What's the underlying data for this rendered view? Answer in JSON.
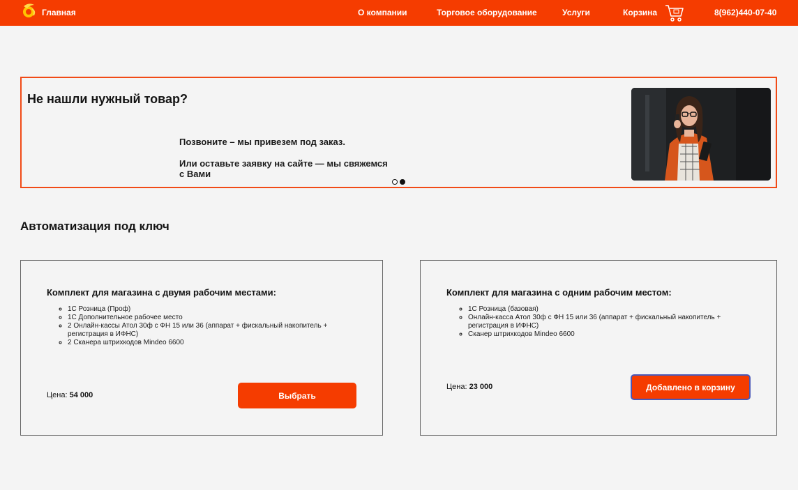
{
  "header": {
    "home_label": "Главная",
    "about_label": "О компании",
    "equipment_label": "Торговое оборудование",
    "services_label": "Услуги",
    "cart_label": "Корзина",
    "phone": "8(962)440-07-40",
    "icons": {
      "logo": "brand-logo-icon",
      "cart": "shopping-cart-icon"
    },
    "colors": {
      "background": "#f53c00",
      "text": "#ffffff"
    }
  },
  "banner": {
    "title": "Не нашли нужный товар?",
    "text1": "Позвоните – мы привезем под заказ.",
    "text2": "Или оставьте заявку на сайте — мы свяжемся с Вами",
    "slides_total": 2,
    "active_slide": 2,
    "border_color": "#f14a16"
  },
  "section": {
    "title": "Автоматизация под ключ"
  },
  "cards": [
    {
      "title": "Комплект для магазина с двумя рабочим местами:",
      "items": [
        "1С Розница (Проф)",
        "1С Дополнительное рабочее место",
        "2 Онлайн-кассы Атол 30ф с ФН 15 или 36 (аппарат + фискальный накопитель + регистрация в ИФНС)",
        "2 Сканера штрихкодов Mindeo 6600"
      ],
      "price_label": "Цена:",
      "price_value": "54 000",
      "button_label": "Выбрать"
    },
    {
      "title": "Комплект для магазина с одним рабочим местом:",
      "items": [
        "1С Розница (базовая)",
        "Онлайн-касса Атол 30ф с ФН 15 или 36 (аппарат + фискальный накопитель + регистрация в ИФНС)",
        "Сканер штрихкодов Mindeo 6600"
      ],
      "price_label": "Цена:",
      "price_value": "23 000",
      "button_label": "Добавлено в корзину"
    }
  ],
  "colors": {
    "accent": "#f53c00",
    "page_background": "#f4f4f4",
    "added_button_border": "#4a58b8"
  }
}
